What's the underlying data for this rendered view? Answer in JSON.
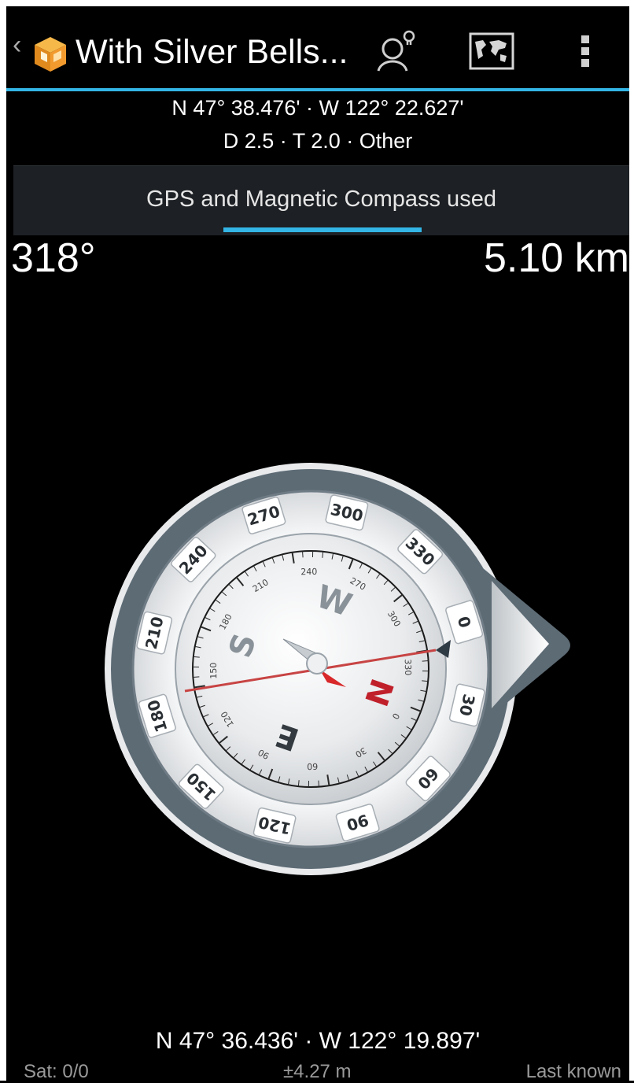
{
  "actionbar": {
    "title": "With Silver Bells...",
    "back_icon": "chevron-left-icon",
    "app_icon": "geocache-cube-icon",
    "navigate_icon": "navigate-person-bulb-icon",
    "map_icon": "world-map-icon",
    "overflow_icon": "overflow-menu-icon"
  },
  "target": {
    "coords": "N 47° 38.476' · W 122° 22.627'",
    "details": "D 2.5 · T 2.0 · Other"
  },
  "status": {
    "text": "GPS and Magnetic Compass used"
  },
  "readout": {
    "bearing": "318°",
    "distance": "5.10 km"
  },
  "compass": {
    "outer_ring_labels": [
      "270",
      "300",
      "330",
      "0",
      "30",
      "60",
      "90",
      "120",
      "150",
      "180",
      "210",
      "240"
    ],
    "inner_ring_labels": [
      "210",
      "240",
      "270",
      "300",
      "330",
      "0",
      "30",
      "60",
      "90",
      "120",
      "150",
      "180"
    ],
    "cardinals": {
      "north": "N",
      "south": "S",
      "east": "E",
      "west": "W"
    }
  },
  "current": {
    "coords": "N 47° 36.436' · W 122° 19.897'"
  },
  "footer": {
    "satellites": "Sat: 0/0",
    "accuracy": "±4.27 m",
    "fix_state": "Last known"
  },
  "colors": {
    "accent": "#33b5e5",
    "status_bg": "#1d2024",
    "needle_red": "#d8282a"
  }
}
